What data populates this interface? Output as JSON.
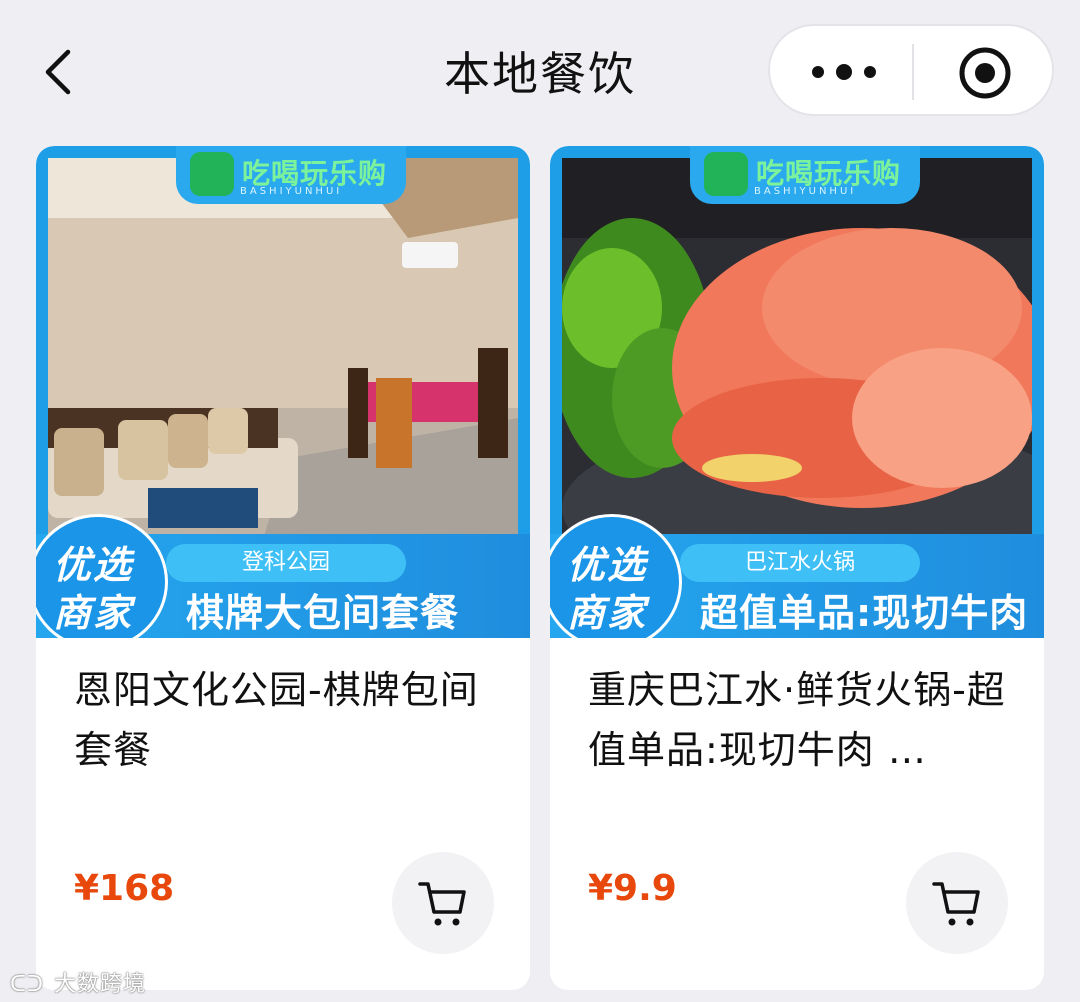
{
  "header": {
    "title": "本地餐饮",
    "back_icon": "chevron-left-icon",
    "more_icon": "more-dots-icon",
    "close_icon": "target-icon"
  },
  "products": [
    {
      "brand_name": "吃喝玩乐购",
      "brand_sub": "BASHIYUNHUI",
      "badge_text": "优选商家",
      "location": "登科公园",
      "offer": "棋牌大包间套餐",
      "name": "恩阳文化公园-棋牌包间套餐",
      "price": "¥168",
      "image_subject": "private card room with sofa and mahjong table"
    },
    {
      "brand_name": "吃喝玩乐购",
      "brand_sub": "BASHIYUNHUI",
      "badge_text": "优选商家",
      "location": "巴江水火锅",
      "offer": "超值单品:现切牛肉",
      "name": "重庆巴江水·鲜货火锅-超值单品:现切牛肉 …",
      "price": "¥9.9",
      "image_subject": "sliced raw beef with parsley on a plate"
    }
  ],
  "watermark": "大数跨境",
  "colors": {
    "accent_blue": "#1e9ee6",
    "price_red": "#e8480c",
    "background": "#efeff3"
  }
}
